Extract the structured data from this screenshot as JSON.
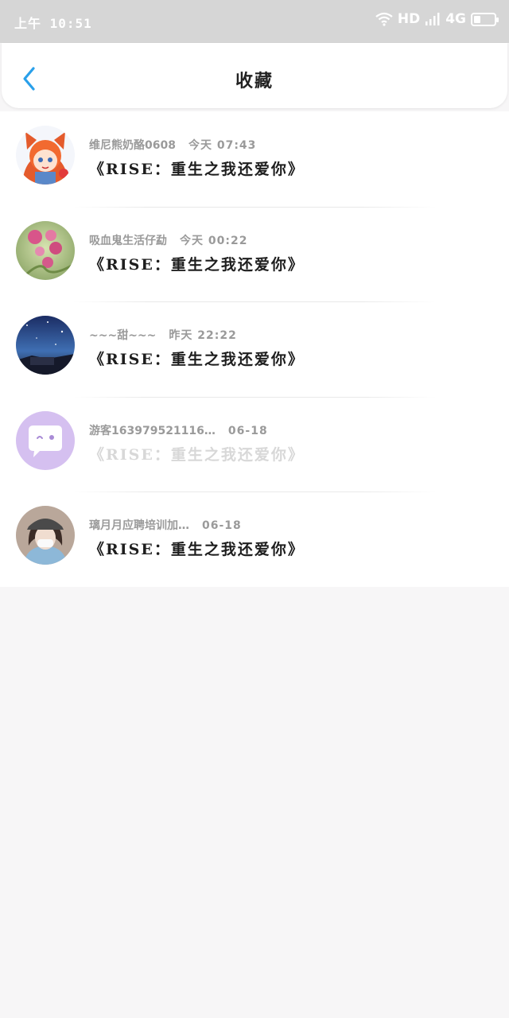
{
  "status_bar": {
    "time": "上午 10:51",
    "network_hd": "HD",
    "network_type": "4G",
    "battery_level": 0.35,
    "icons": [
      "wifi-icon",
      "signal-icon",
      "battery-icon"
    ]
  },
  "header": {
    "title": "收藏",
    "back_icon": "chevron-left-icon",
    "accent_color": "#2aa0ea"
  },
  "favorites": [
    {
      "user": "维尼熊奶酪0608",
      "time": "今天 07:43",
      "book": "《RISE：重生之我还爱你》",
      "avatar": "cartoon-girl-avatar"
    },
    {
      "user": "吸血鬼生活仔勐",
      "time": "今天 00:22",
      "book": "《RISE：重生之我还爱你》",
      "avatar": "flower-avatar"
    },
    {
      "user": "~~~甜~~~",
      "time": "昨天 22:22",
      "book": "《RISE：重生之我还爱你》",
      "avatar": "night-sky-avatar"
    },
    {
      "user": "游客163979521116…",
      "time": "06-18",
      "book": "《RISE：重生之我还爱你》",
      "avatar": "default-chat-avatar"
    },
    {
      "user": "璃月月应聘培训加…",
      "time": "06-18",
      "book": "《RISE：重生之我还爱你》",
      "avatar": "girl-photo-avatar"
    }
  ]
}
